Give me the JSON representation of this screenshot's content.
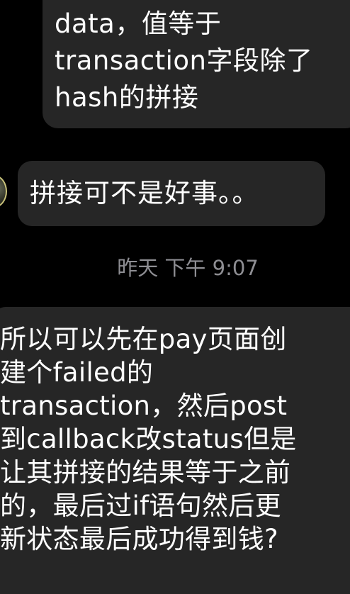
{
  "messages": {
    "top": {
      "lines": [
        "data，值等于",
        "transaction字段除了",
        "hash的拼接"
      ]
    },
    "middle": {
      "text": "拼接可不是好事。。"
    },
    "timestamp": "昨天 下午 9:07",
    "bottom": {
      "lines": [
        "所以可以先在pay页面创",
        "建个failed的",
        "transaction，然后post",
        "到callback改status但是",
        "让其拼接的结果等于之前",
        "的，最后过if语句然后更",
        "新状态最后成功得到钱?"
      ]
    }
  },
  "colors": {
    "background": "#000000",
    "bubble": "#262626",
    "text": "#ffffff",
    "timestamp": "#8e8e93"
  }
}
